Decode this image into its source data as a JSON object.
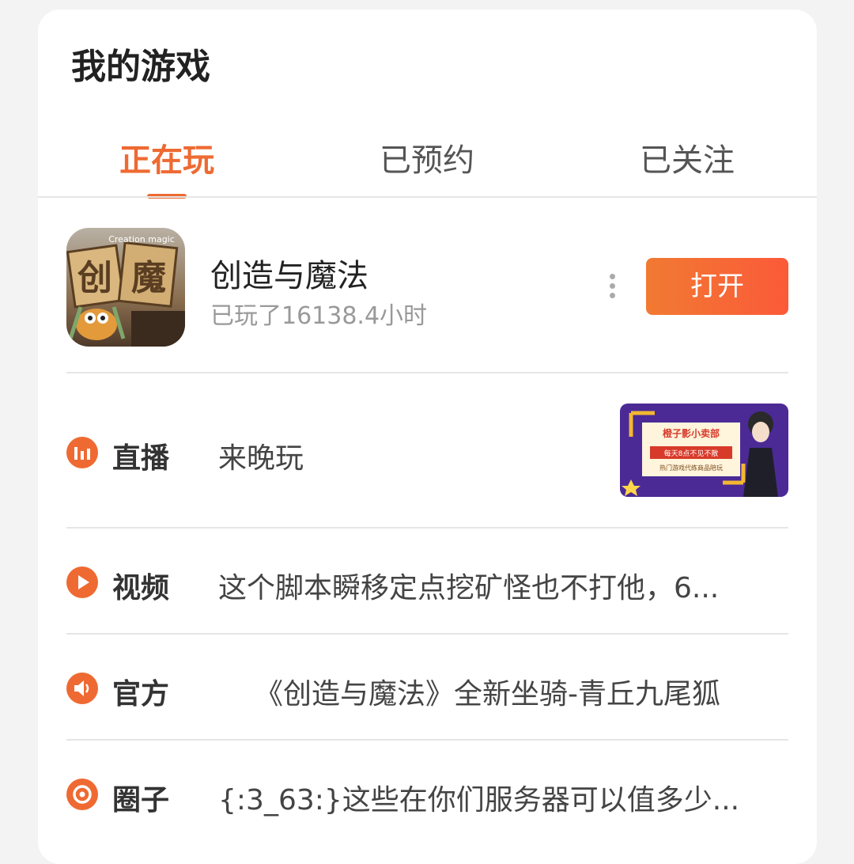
{
  "header": {
    "title": "我的游戏"
  },
  "tabs": [
    {
      "label": "正在玩",
      "active": true
    },
    {
      "label": "已预约",
      "active": false
    },
    {
      "label": "已关注",
      "active": false
    }
  ],
  "game": {
    "name": "创造与魔法",
    "play_time": "已玩了16138.4小时",
    "open_label": "打开",
    "icon_text": "创魔",
    "icon_caption": "Creation magic"
  },
  "rows": [
    {
      "icon": "live-bars-icon",
      "label": "直播",
      "text": "来晚玩"
    },
    {
      "icon": "play-icon",
      "label": "视频",
      "text": "这个脚本瞬移定点挖矿怪也不打他，6..."
    },
    {
      "icon": "speaker-icon",
      "label": "官方",
      "text": "《创造与魔法》全新坐骑-青丘九尾狐"
    },
    {
      "icon": "circle-target-icon",
      "label": "圈子",
      "text": "{:3_63:}这些在你们服务器可以值多少..."
    }
  ],
  "live_thumb": {
    "title": "橙子影小卖部",
    "line1": "每天8点不见不散",
    "line2": "热门游戏代练商品陪玩"
  },
  "colors": {
    "accent": "#ee6a32",
    "button_start": "#f17a32",
    "button_end": "#fb5a39"
  }
}
